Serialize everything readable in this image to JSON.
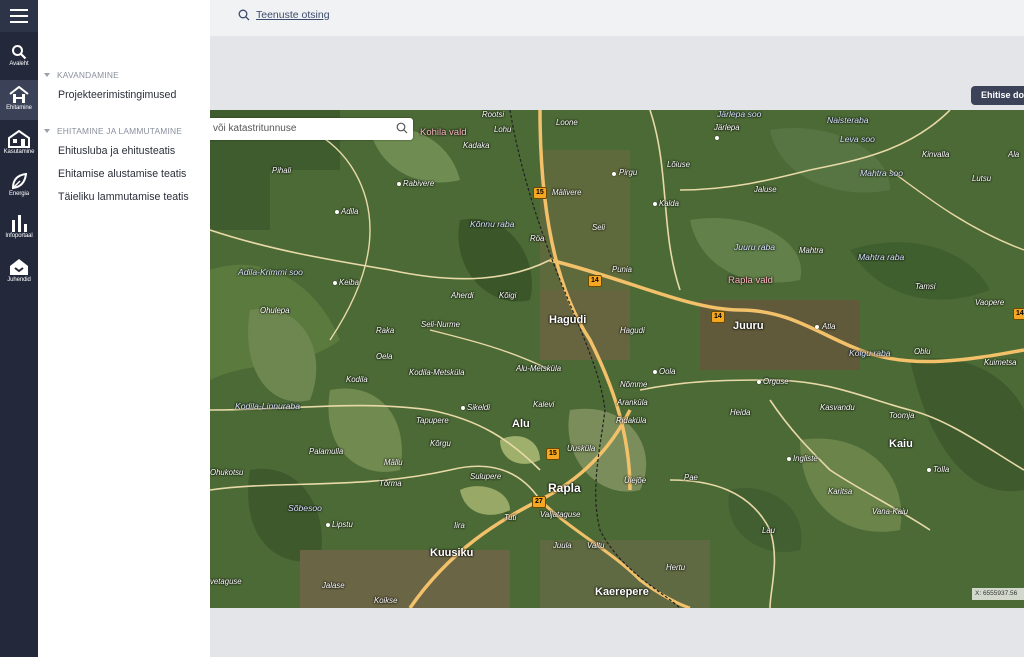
{
  "rail": {
    "items": [
      {
        "label": "Avaleht",
        "icon": "search-icon"
      },
      {
        "label": "Ehitamine",
        "icon": "building-icon"
      },
      {
        "label": "Kasutamine",
        "icon": "house-use-icon"
      },
      {
        "label": "Energia",
        "icon": "leaf-icon"
      },
      {
        "label": "Infoportaal",
        "icon": "bar-chart-icon"
      },
      {
        "label": "Juhendid",
        "icon": "guide-house-icon"
      }
    ]
  },
  "panel": {
    "sections": [
      {
        "title": "KAVANDAMINE",
        "links": [
          "Projekteerimistingimused"
        ]
      },
      {
        "title": "EHITAMINE JA LAMMUTAMINE",
        "links": [
          "Ehitusluba ja ehitusteatis",
          "Ehitamise alustamise teatis",
          "Täieliku lammutamise teatis"
        ]
      }
    ]
  },
  "topbar": {
    "search_label": "Teenuste otsing"
  },
  "ehitise_button": "Ehitise do",
  "map": {
    "search_placeholder": "või katastritunnuse",
    "coords": "X: 6555937.56",
    "colors": {
      "road": "#f3c16a",
      "forest": "#3f5f30",
      "field": "#6f8f4c"
    },
    "labels": {
      "rootsi": "Rootsi",
      "loone": "Loone",
      "jarlepa_soo": "Järlepa soo",
      "jarlepa": "Järlepa",
      "naisteraba": "Naisteraba",
      "leva_soo": "Leva soo",
      "lohu": "Lohu",
      "kadaka": "Kadaka",
      "kohila_vald": "Kohila vald",
      "pirgu": "Pirgu",
      "loiuse": "Lõiuse",
      "kinvalla": "Kinvalla",
      "ala": "Ala",
      "pihali": "Pihali",
      "rabivere": "Rabivere",
      "malivere": "Mälivere",
      "mahtra_soo": "Mahtra soo",
      "lutsu": "Lutsu",
      "jaluse": "Jaluse",
      "adila": "Adila",
      "kalda": "Kalda",
      "konnu_raba": "Kõnnu raba",
      "seli": "Seli",
      "roa": "Röa",
      "juuru_raba": "Juuru raba",
      "mahtra": "Mahtra",
      "mahtra_raba": "Mahtra raba",
      "adila_krimmi_soo": "Adila-Krimmi soo",
      "punia": "Punia",
      "keiba": "Keiba",
      "rapla_vald": "Rapla vald",
      "tamsi": "Tamsi",
      "aherdi": "Aherdi",
      "koigi": "Kõigi",
      "vaopere": "Vaopere",
      "ohulepa": "Ohulepa",
      "hagudi": "Hagudi",
      "hagudi_v": "Hagudi",
      "juuru": "Juuru",
      "atla": "Atla",
      "raka": "Raka",
      "seli_nurme": "Seli-Nurme",
      "kolgu_raba": "Kolgu raba",
      "oblu": "Oblu",
      "kuimetsa": "Kuimetsa",
      "oela": "Oela",
      "alu_metskula": "Alu-Metsküla",
      "oola": "Oola",
      "kodila": "Kodila",
      "kodila_metskula": "Kodila-Metsküla",
      "nomme": "Nõmme",
      "orguse": "Orguse",
      "kalevi": "Kalevi",
      "arankula": "Aranküla",
      "kasvandu": "Kasvandu",
      "kodila_linnuraba": "Kodila-Linnuraba",
      "sikeldi": "Sikeldi",
      "heida": "Heida",
      "toomja": "Toomja",
      "tapupere": "Tapupere",
      "ridakula": "Ridaküla",
      "alu": "Alu",
      "korgu": "Kõrgu",
      "kaiu": "Kaiu",
      "palamulla": "Palamulla",
      "uusikula": "Uusküla",
      "ingliste": "Ingliste",
      "mallu": "Mällu",
      "ohukotsu": "Ohukotsu",
      "tolla": "Tolla",
      "torma": "Tõrma",
      "sulupere": "Sulupere",
      "ulejoe": "Ülejõe",
      "pae": "Pae",
      "rapla": "Rapla",
      "karitsa": "Karitsa",
      "sobesoo": "Sõbesoo",
      "valjataguse": "Valjataguse",
      "vana_kaiu": "Vana-Kaiu",
      "tuti": "Tuti",
      "lipstu": "Lipstu",
      "iira": "Iira",
      "lau": "Lau",
      "juula": "Juula",
      "valtu": "Valtu",
      "kuusiku": "Kuusiku",
      "hertu": "Hertu",
      "vetaguse": "vetaguse",
      "jalase": "Jalase",
      "kaerepere": "Kaerepere",
      "koikse": "Koikse"
    },
    "shields": {
      "r15a": "15",
      "r14a": "14",
      "r14b": "14",
      "r14c": "14",
      "r15b": "15",
      "r27": "27"
    }
  }
}
